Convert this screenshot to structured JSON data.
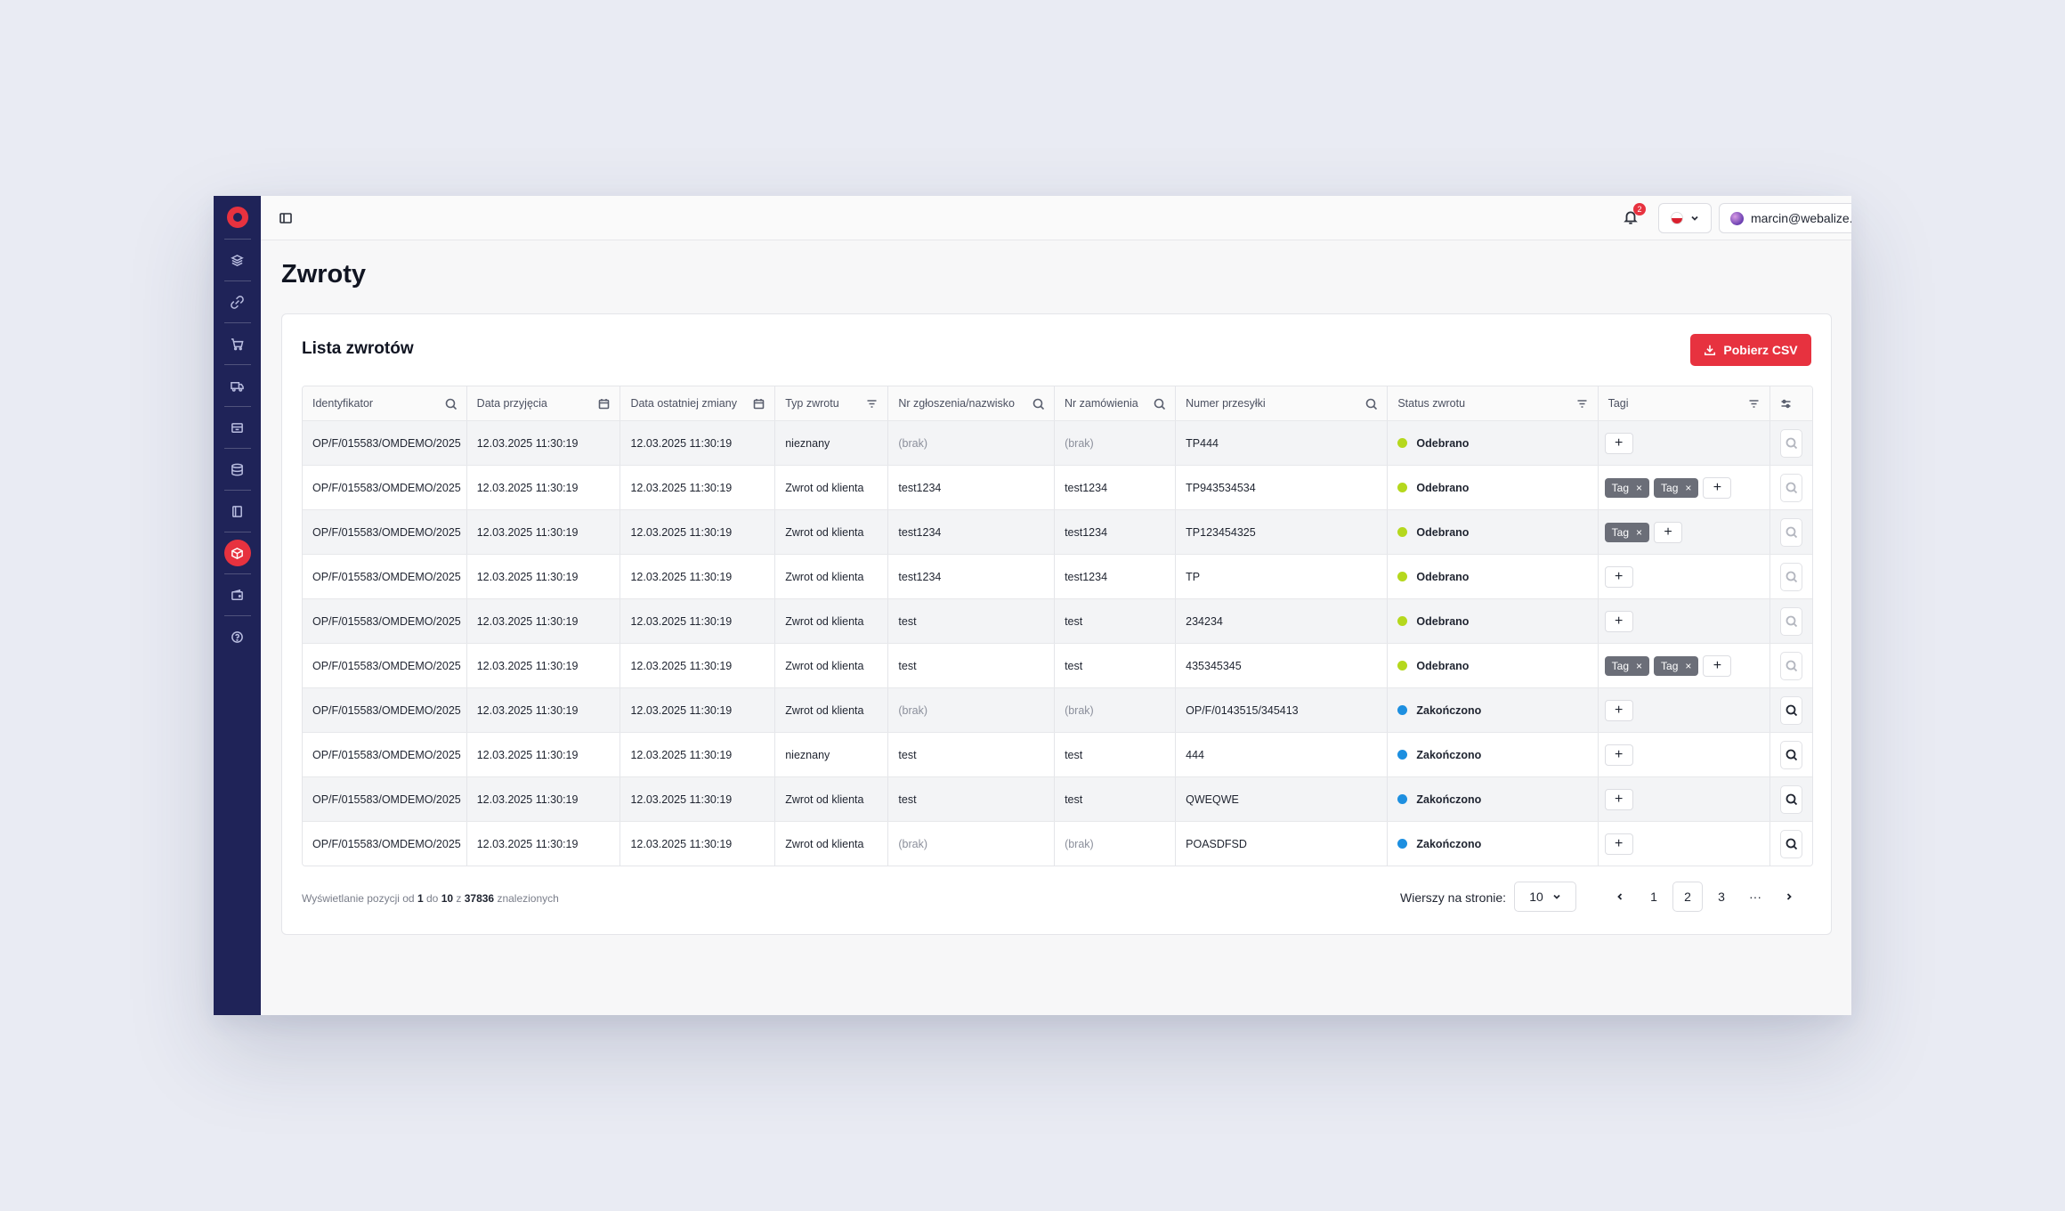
{
  "topbar": {
    "notifications_count": "2",
    "user_label": "marcin@webalize...."
  },
  "page": {
    "title": "Zwroty",
    "card_title": "Lista zwrotów",
    "csv_button": "Pobierz CSV"
  },
  "table": {
    "columns": [
      "Identyfikator",
      "Data przyjęcia",
      "Data ostatniej zmiany",
      "Typ zwrotu",
      "Nr zgłoszenia/nazwisko",
      "Nr zamówienia",
      "Numer przesyłki",
      "Status zwrotu",
      "Tagi"
    ],
    "rows": [
      {
        "id": "OP/F/015583/OMDEMO/2025",
        "received": "12.03.2025 11:30:19",
        "changed": "12.03.2025 11:30:19",
        "type": "nieznany",
        "claim": "(brak)",
        "order": "(brak)",
        "shipment": "TP444",
        "status": "Odebrano"
      },
      {
        "id": "OP/F/015583/OMDEMO/2025",
        "received": "12.03.2025 11:30:19",
        "changed": "12.03.2025 11:30:19",
        "type": "Zwrot od klienta",
        "claim": "test1234",
        "order": "test1234",
        "shipment": "TP943534534",
        "status": "Odebrano"
      },
      {
        "id": "OP/F/015583/OMDEMO/2025",
        "received": "12.03.2025 11:30:19",
        "changed": "12.03.2025 11:30:19",
        "type": "Zwrot od klienta",
        "claim": "test1234",
        "order": "test1234",
        "shipment": "TP123454325",
        "status": "Odebrano"
      },
      {
        "id": "OP/F/015583/OMDEMO/2025",
        "received": "12.03.2025 11:30:19",
        "changed": "12.03.2025 11:30:19",
        "type": "Zwrot od klienta",
        "claim": "test1234",
        "order": "test1234",
        "shipment": "TP",
        "status": "Odebrano"
      },
      {
        "id": "OP/F/015583/OMDEMO/2025",
        "received": "12.03.2025 11:30:19",
        "changed": "12.03.2025 11:30:19",
        "type": "Zwrot od klienta",
        "claim": "test",
        "order": "test",
        "shipment": "234234",
        "status": "Odebrano"
      },
      {
        "id": "OP/F/015583/OMDEMO/2025",
        "received": "12.03.2025 11:30:19",
        "changed": "12.03.2025 11:30:19",
        "type": "Zwrot od klienta",
        "claim": "test",
        "order": "test",
        "shipment": "435345345",
        "status": "Odebrano"
      },
      {
        "id": "OP/F/015583/OMDEMO/2025",
        "received": "12.03.2025 11:30:19",
        "changed": "12.03.2025 11:30:19",
        "type": "Zwrot od klienta",
        "claim": "(brak)",
        "order": "(brak)",
        "shipment": "OP/F/0143515/345413",
        "status": "Zakończono"
      },
      {
        "id": "OP/F/015583/OMDEMO/2025",
        "received": "12.03.2025 11:30:19",
        "changed": "12.03.2025 11:30:19",
        "type": "nieznany",
        "claim": "test",
        "order": "test",
        "shipment": "444",
        "status": "Zakończono"
      },
      {
        "id": "OP/F/015583/OMDEMO/2025",
        "received": "12.03.2025 11:30:19",
        "changed": "12.03.2025 11:30:19",
        "type": "Zwrot od klienta",
        "claim": "test",
        "order": "test",
        "shipment": "QWEQWE",
        "status": "Zakończono"
      },
      {
        "id": "OP/F/015583/OMDEMO/2025",
        "received": "12.03.2025 11:30:19",
        "changed": "12.03.2025 11:30:19",
        "type": "Zwrot od klienta",
        "claim": "(brak)",
        "order": "(brak)",
        "shipment": "POASDFSD",
        "status": "Zakończono"
      }
    ],
    "tag_label": "Tag",
    "tag_close": "×",
    "add_symbol": "+",
    "status_colors": {
      "Odebrano": "#b5d81d",
      "Zakończono": "#1d8fe0"
    }
  },
  "footer": {
    "summary_prefix": "Wyświetlanie pozycji od",
    "summary_from": "1",
    "summary_to_word": "do",
    "summary_to": "10",
    "summary_of_word": "z",
    "summary_total": "37836",
    "summary_suffix": "znalezionych",
    "rows_label": "Wierszy na stronie:",
    "rows_value": "10",
    "pages": [
      "1",
      "2",
      "3"
    ],
    "current_page": "2",
    "ellipsis": "···"
  },
  "colors": {
    "accent": "#e7323f",
    "sidebar": "#1f2358"
  }
}
